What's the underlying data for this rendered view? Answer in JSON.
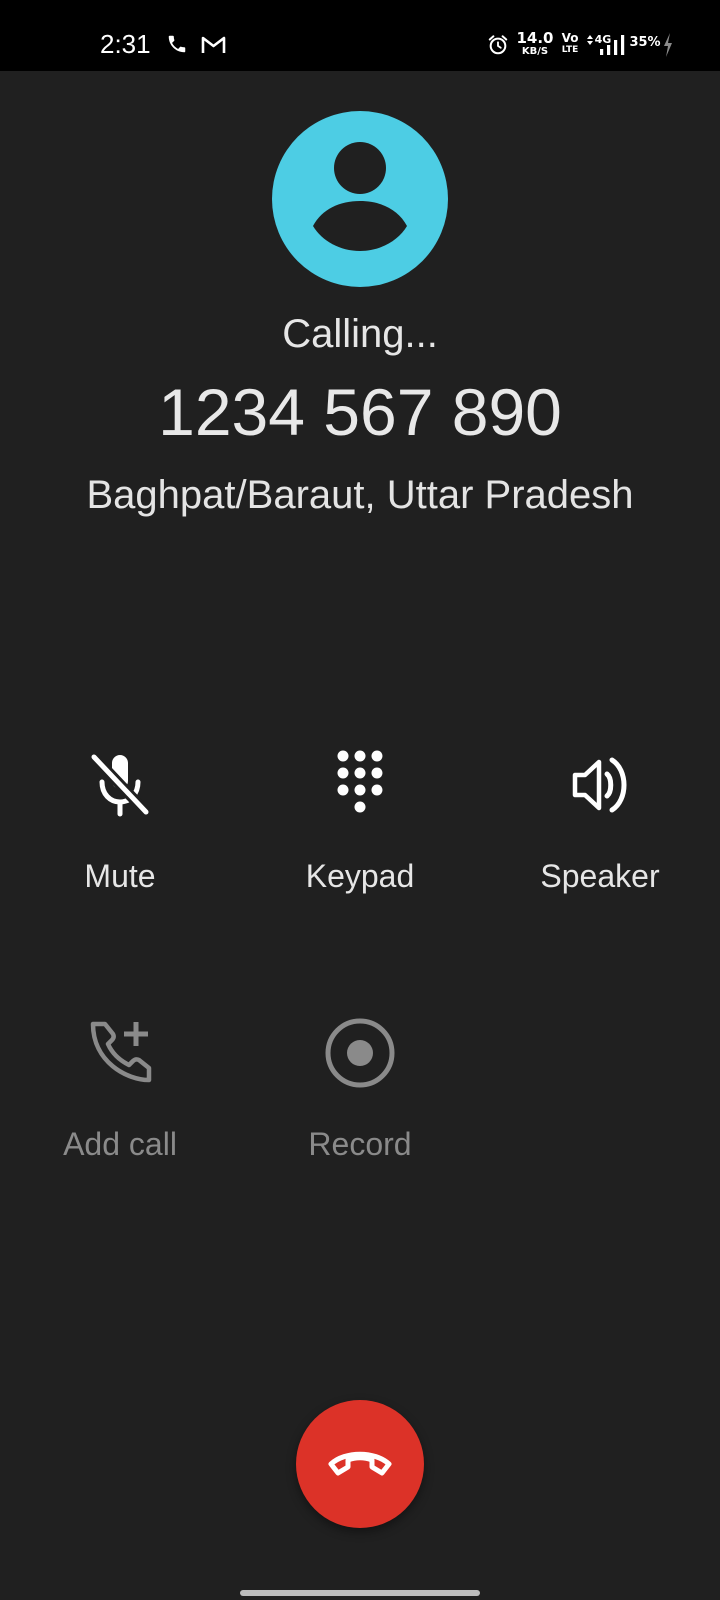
{
  "status_bar": {
    "time": "2:31",
    "icons": [
      "phone-icon",
      "gmail-icon",
      "alarm-icon",
      "volte-icon",
      "signal-4g-icon",
      "battery-charging-icon"
    ],
    "network_speed_value": "14.0",
    "network_speed_unit": "KB/S",
    "volte_top": "Vo",
    "volte_bottom": "LTE",
    "network_type": "4G",
    "battery": "35%"
  },
  "call": {
    "avatar_icon": "person-icon",
    "avatar_color": "#4dcde4",
    "status": "Calling...",
    "number": "1234 567 890",
    "location": "Baghpat/Baraut, Uttar Pradesh"
  },
  "controls": {
    "mute": {
      "label": "Mute",
      "icon": "mic-off-icon",
      "enabled": true
    },
    "keypad": {
      "label": "Keypad",
      "icon": "dialpad-icon",
      "enabled": true
    },
    "speaker": {
      "label": "Speaker",
      "icon": "volume-icon",
      "enabled": true
    },
    "add_call": {
      "label": "Add call",
      "icon": "add-call-icon",
      "enabled": false
    },
    "record": {
      "label": "Record",
      "icon": "record-icon",
      "enabled": false
    }
  },
  "end_call": {
    "icon": "call-end-icon",
    "color": "#dc3228"
  }
}
